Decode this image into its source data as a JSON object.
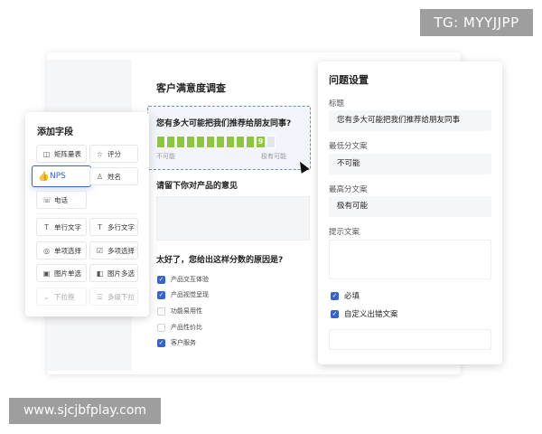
{
  "watermarks": {
    "top": "TG: MYYJJPP",
    "bottom": "www.sjcjbfplay.com"
  },
  "form": {
    "title": "客户满意度调查",
    "nps": {
      "question": "您有多大可能把我们推荐给朋友同事?",
      "selected": "9",
      "min_text": "不可能",
      "max_text": "极有可能"
    },
    "q2": {
      "label": "请留下你对产品的意见"
    },
    "q3": {
      "label": "太好了，您给出这样分数的原因是?",
      "options": [
        {
          "label": "产品交互体验",
          "checked": true
        },
        {
          "label": "产品视觉呈现",
          "checked": true
        },
        {
          "label": "功能易用性",
          "checked": false
        },
        {
          "label": "产品性价比",
          "checked": false
        },
        {
          "label": "客户服务",
          "checked": true
        }
      ]
    }
  },
  "fields_panel": {
    "title": "添加字段",
    "items": {
      "matrix": "矩阵量表",
      "rating": "评分",
      "nps": "NPS",
      "name": "姓名",
      "phone": "电话",
      "single_text": "单行文字",
      "multi_text": "多行文字",
      "single_choice": "单项选择",
      "multi_choice": "多项选择",
      "image_single": "图片单选",
      "image_multi": "图片多选",
      "dropdown": "下拉框",
      "multi_dropdown": "多级下拉"
    }
  },
  "settings": {
    "title": "问题设置",
    "title_label": "标题",
    "title_value": "您有多大可能把我们推荐给朋友同事",
    "min_label": "最低分文案",
    "min_value": "不可能",
    "max_label": "最高分文案",
    "max_value": "极有可能",
    "hint_label": "提示文案",
    "required": "必填",
    "custom_error": "自定义出错文案"
  },
  "colors": {
    "accent": "#3a63c9",
    "nps_green": "#8ec63f"
  }
}
